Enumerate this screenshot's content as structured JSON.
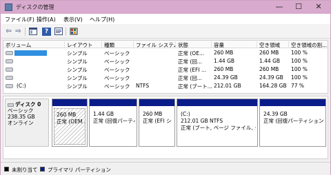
{
  "window": {
    "title": "ディスクの管理",
    "minimize_glyph": "—",
    "maximize_glyph": "☐",
    "close_glyph": "✕"
  },
  "menu": [
    {
      "label": "ファイル(F)"
    },
    {
      "label": "操作(A)"
    },
    {
      "label": "表示(V)"
    },
    {
      "label": "ヘルプ(H)"
    }
  ],
  "toolbar": {
    "icons": [
      "back-arrow-icon",
      "forward-arrow-icon",
      "console-tree-icon",
      "help-icon",
      "properties-icon",
      "disk-settings-icon"
    ],
    "back_glyph": "⇦",
    "forward_glyph": "⇨",
    "help_glyph": "?"
  },
  "volume_list": {
    "columns": [
      "ボリューム",
      "レイアウト",
      "種類",
      "ファイル システム",
      "状態",
      "容量",
      "空き領域",
      "空き領域の割..."
    ],
    "rows": [
      {
        "volume": "",
        "layout": "シンプル",
        "type": "ベーシック",
        "fs": "",
        "status": "正常 (OE...",
        "capacity": "260 MB",
        "free": "260 MB",
        "pct": "100 %",
        "selected": true
      },
      {
        "volume": "",
        "layout": "シンプル",
        "type": "ベーシック",
        "fs": "",
        "status": "正常 (回...",
        "capacity": "1.44 GB",
        "free": "1.44 GB",
        "pct": "100 %"
      },
      {
        "volume": "",
        "layout": "シンプル",
        "type": "ベーシック",
        "fs": "",
        "status": "正常 (EFI ...",
        "capacity": "260 MB",
        "free": "260 MB",
        "pct": "100 %"
      },
      {
        "volume": "",
        "layout": "シンプル",
        "type": "ベーシック",
        "fs": "",
        "status": "正常 (回...",
        "capacity": "24.39 GB",
        "free": "24.39 GB",
        "pct": "100 %"
      },
      {
        "volume": "(C:)",
        "layout": "シンプル",
        "type": "ベーシック",
        "fs": "NTFS",
        "status": "正常 (ブート...",
        "capacity": "212.01 GB",
        "free": "164.28 GB",
        "pct": "77 %"
      }
    ]
  },
  "disk": {
    "name": "ディスク 0",
    "type": "ベーシック",
    "size": "238.35 GB",
    "state": "オンライン",
    "partitions": [
      {
        "line1": "",
        "line2": "260 MB",
        "line3": "正常 (OEM パ",
        "hatched": true
      },
      {
        "line1": "",
        "line2": "1.44 GB",
        "line3": "正常 (回復パーティ"
      },
      {
        "line1": "",
        "line2": "260 MB",
        "line3": "正常 (EFI シ"
      },
      {
        "line1": "(C:)",
        "line2": "212.01 GB NTFS",
        "line3": "正常 (ブート, ページ ファイル, クラッ"
      },
      {
        "line1": "",
        "line2": "24.39 GB",
        "line3": "正常 (回復パーティション)"
      }
    ]
  },
  "legend": [
    {
      "label": "未割り当て",
      "color": "#000000"
    },
    {
      "label": "プライマリ パーティション",
      "color": "#0a1c8a"
    }
  ],
  "colors": {
    "titlebar": "#d8aacd",
    "partition_bar": "#0a1c8a",
    "selection": "#2f8fe0"
  }
}
